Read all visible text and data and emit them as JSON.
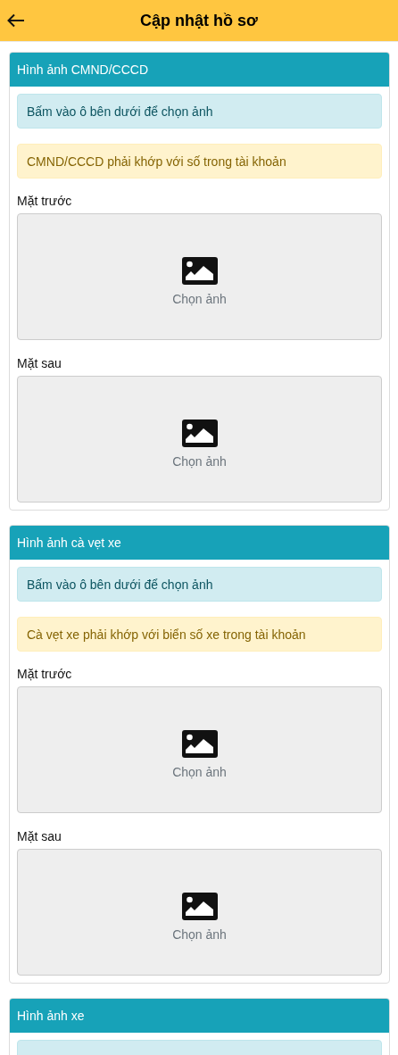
{
  "header": {
    "title": "Cập nhật hồ sơ"
  },
  "sections": [
    {
      "title": "Hình ảnh CMND/CCCD",
      "info": "Bấm vào ô bên dưới để chọn ảnh",
      "warning": "CMND/CCCD phải khớp với số trong tài khoản",
      "uploads": [
        {
          "label": "Mặt trước",
          "button": "Chọn ảnh"
        },
        {
          "label": "Mặt sau",
          "button": "Chọn ảnh"
        }
      ]
    },
    {
      "title": "Hình ảnh cà vẹt xe",
      "info": "Bấm vào ô bên dưới để chọn ảnh",
      "warning": "Cà vẹt xe phải khớp với biển số xe trong tài khoản",
      "uploads": [
        {
          "label": "Mặt trước",
          "button": "Chọn ảnh"
        },
        {
          "label": "Mặt sau",
          "button": "Chọn ảnh"
        }
      ]
    },
    {
      "title": "Hình ảnh xe",
      "kind": "cut"
    }
  ]
}
